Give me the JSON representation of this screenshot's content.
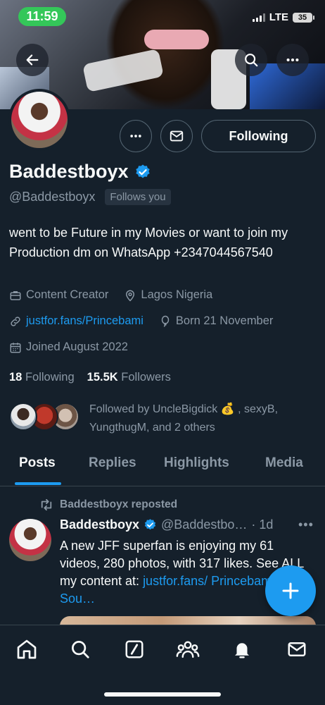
{
  "status_bar": {
    "time": "11:59",
    "network": "LTE",
    "battery": "35"
  },
  "profile": {
    "name": "Baddestboyx",
    "handle": "@Baddestboyx",
    "follows_you": "Follows you",
    "follow_button": "Following",
    "bio": "went to be Future in my Movies or want to join my Production dm on WhatsApp +2347044567540",
    "category": "Content Creator",
    "location": "Lagos Nigeria",
    "website": "justfor.fans/Princebami",
    "birthday": "Born 21 November",
    "joined": "Joined August 2022",
    "following_count": "18",
    "following_label": "Following",
    "followers_count": "15.5K",
    "followers_label": "Followers",
    "followed_by": "Followed by UncleBigdick 💰 , sexyB, YungthugM, and 2 others"
  },
  "tabs": [
    "Posts",
    "Replies",
    "Highlights",
    "Media"
  ],
  "post": {
    "repost_label": "Baddestboyx reposted",
    "author_name": "Baddestboyx",
    "author_handle": "@Baddestbo…",
    "time": "· 1d",
    "text": "A new JFF superfan is enjoying my 61 videos, 280 photos, with 317 likes. See ALL my content at: ",
    "link": "justfor.fans/ Princebami?Sou…"
  },
  "colors": {
    "background": "#15202b",
    "accent": "#1d9bf0",
    "verified": "#1d9bf0",
    "muted": "#8b98a5"
  }
}
